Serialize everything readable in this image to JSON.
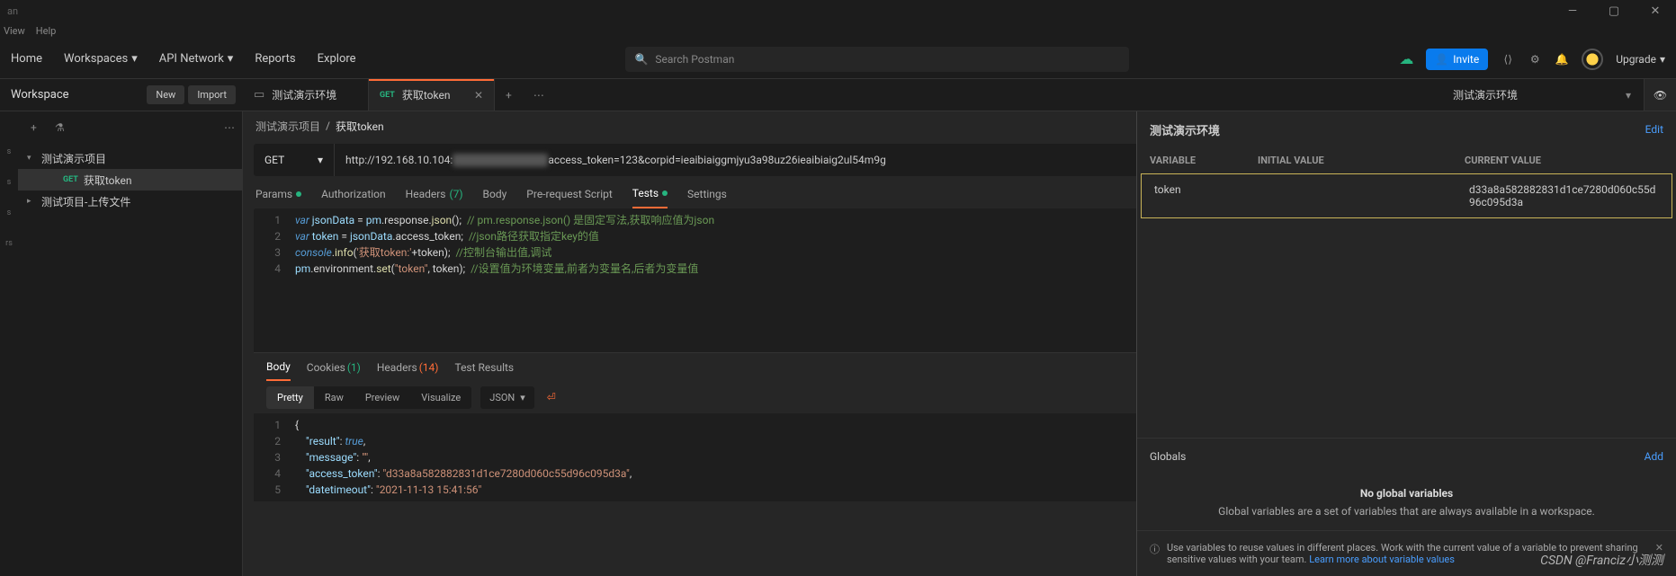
{
  "title": "an",
  "menu": {
    "view": "View",
    "help": "Help"
  },
  "winbtns": {
    "min": "—",
    "max": "▢",
    "close": "✕"
  },
  "nav": {
    "home": "Home",
    "workspaces": "Workspaces",
    "api_network": "API Network",
    "reports": "Reports",
    "explore": "Explore",
    "search_placeholder": "Search Postman",
    "invite": "Invite",
    "upgrade": "Upgrade"
  },
  "ws": {
    "label": "Workspace",
    "new": "New",
    "import": "Import"
  },
  "tabs": [
    {
      "kind": "env",
      "label": "测试演示环境",
      "active": false
    },
    {
      "kind": "req",
      "method": "GET",
      "label": "获取token",
      "active": true
    }
  ],
  "env_selector": "测试演示环境",
  "tree": {
    "c1": {
      "label": "测试演示项目",
      "open": true
    },
    "c1_r1": {
      "method": "GET",
      "label": "获取token"
    },
    "c2": {
      "label": "测试项目-上传文件",
      "open": false
    }
  },
  "breadcrumb": {
    "a": "测试演示项目",
    "sep": "/",
    "b": "获取token"
  },
  "request": {
    "method": "GET",
    "url_pre": "http://192.168.10.104:",
    "url_blur": "████████████",
    "url_post": "access_token=123&corpid=ieaibiaiggmjyu3a98uz26ieaibiaig2ul54m9g"
  },
  "req_tabs": {
    "params": "Params",
    "auth": "Authorization",
    "headers": "Headers",
    "headers_count": "(7)",
    "body": "Body",
    "prereq": "Pre-request Script",
    "tests": "Tests",
    "settings": "Settings"
  },
  "tests_code": {
    "lines": [
      "1",
      "2",
      "3",
      "4"
    ],
    "l1": {
      "a": "var",
      "b": " jsonData ",
      "c": "=",
      "d": " pm",
      "e": ".response.",
      "f": "json",
      "g": "();  ",
      "h": "// pm.response.json() 是固定写法,获取响应值为json"
    },
    "l2": {
      "a": "var",
      "b": " token ",
      "c": "=",
      "d": " jsonData",
      "e": ".access_token;  ",
      "f": "//json路径获取指定key的值"
    },
    "l3": {
      "a": "console",
      "b": ".",
      "c": "info",
      "d": "(",
      "e": "'获取token:'",
      "f": "+token);  ",
      "g": "//控制台输出值,调试"
    },
    "l4": {
      "a": "pm",
      "b": ".environment.",
      "c": "set",
      "d": "(",
      "e": "\"token\"",
      "f": ", token);  ",
      "g": "//设置值为环境变量,前者为变量名,后者为变量值"
    }
  },
  "resp_tabs": {
    "body": "Body",
    "cookies": "Cookies",
    "cookies_count": "(1)",
    "headers": "Headers",
    "headers_count": "(14)",
    "tests": "Test Results"
  },
  "view": {
    "pretty": "Pretty",
    "raw": "Raw",
    "preview": "Preview",
    "visualize": "Visualize",
    "json": "JSON"
  },
  "resp_body": {
    "lines": [
      "1",
      "2",
      "3",
      "4",
      "5"
    ],
    "l1": "{",
    "l2": {
      "k": "\"result\"",
      "v": "true",
      "c": ","
    },
    "l3": {
      "k": "\"message\"",
      "v": "\"\"",
      "c": ","
    },
    "l4": {
      "k": "\"access_token\"",
      "v": "\"d33a8a582882831d1ce7280d060c55d96c095d3a\"",
      "c": ","
    },
    "l5": {
      "k": "\"datetimeout\"",
      "v": "\"2021-11-13 15:41:56\""
    }
  },
  "env_panel": {
    "title": "测试演示环境",
    "edit": "Edit",
    "hdr_var": "VARIABLE",
    "hdr_init": "INITIAL VALUE",
    "hdr_cur": "CURRENT VALUE",
    "row1": {
      "var": "token",
      "init": "",
      "cur": "d33a8a582882831d1ce7280d060c55d96c095d3a"
    },
    "globals": "Globals",
    "add": "Add",
    "empty_title": "No global variables",
    "empty_sub": "Global variables are a set of variables that are always available in a workspace.",
    "tip": "Use variables to reuse values in different places. Work with the current value of a variable to prevent sharing sensitive values with your team. ",
    "tip_link": "Learn more about variable values"
  },
  "watermark": "CSDN @Franciz小测测"
}
